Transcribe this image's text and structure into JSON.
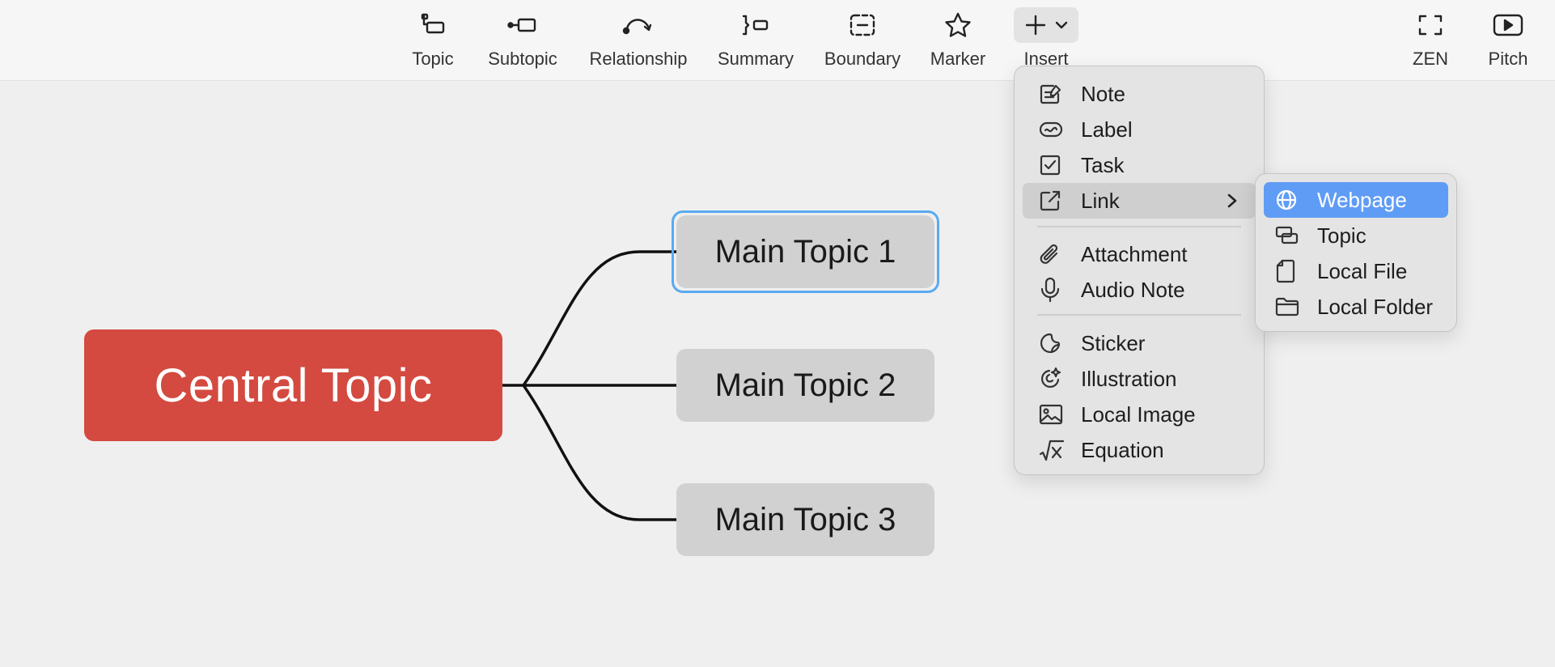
{
  "toolbar": {
    "topic": "Topic",
    "subtopic": "Subtopic",
    "relationship": "Relationship",
    "summary": "Summary",
    "boundary": "Boundary",
    "marker": "Marker",
    "insert": "Insert",
    "zen": "ZEN",
    "pitch": "Pitch"
  },
  "canvas": {
    "central_topic": "Central Topic",
    "main_topics": [
      "Main Topic 1",
      "Main Topic 2",
      "Main Topic 3"
    ]
  },
  "insert_menu": {
    "items": [
      {
        "label": "Note",
        "icon": "note-icon"
      },
      {
        "label": "Label",
        "icon": "label-icon"
      },
      {
        "label": "Task",
        "icon": "task-icon"
      },
      {
        "label": "Link",
        "icon": "link-icon"
      },
      {
        "label": "Attachment",
        "icon": "paperclip-icon"
      },
      {
        "label": "Audio Note",
        "icon": "microphone-icon"
      },
      {
        "label": "Sticker",
        "icon": "sticker-icon"
      },
      {
        "label": "Illustration",
        "icon": "illustration-icon"
      },
      {
        "label": "Local Image",
        "icon": "image-icon"
      },
      {
        "label": "Equation",
        "icon": "equation-icon"
      }
    ]
  },
  "link_submenu": {
    "items": [
      {
        "label": "Webpage",
        "icon": "globe-icon"
      },
      {
        "label": "Topic",
        "icon": "topic-link-icon"
      },
      {
        "label": "Local File",
        "icon": "file-icon"
      },
      {
        "label": "Local Folder",
        "icon": "folder-icon"
      }
    ]
  },
  "colors": {
    "central_topic": "#d44a40",
    "main_topic": "#d1d1d1",
    "selection": "#5aaaf0",
    "menu_highlight": "#5f9cf5"
  }
}
